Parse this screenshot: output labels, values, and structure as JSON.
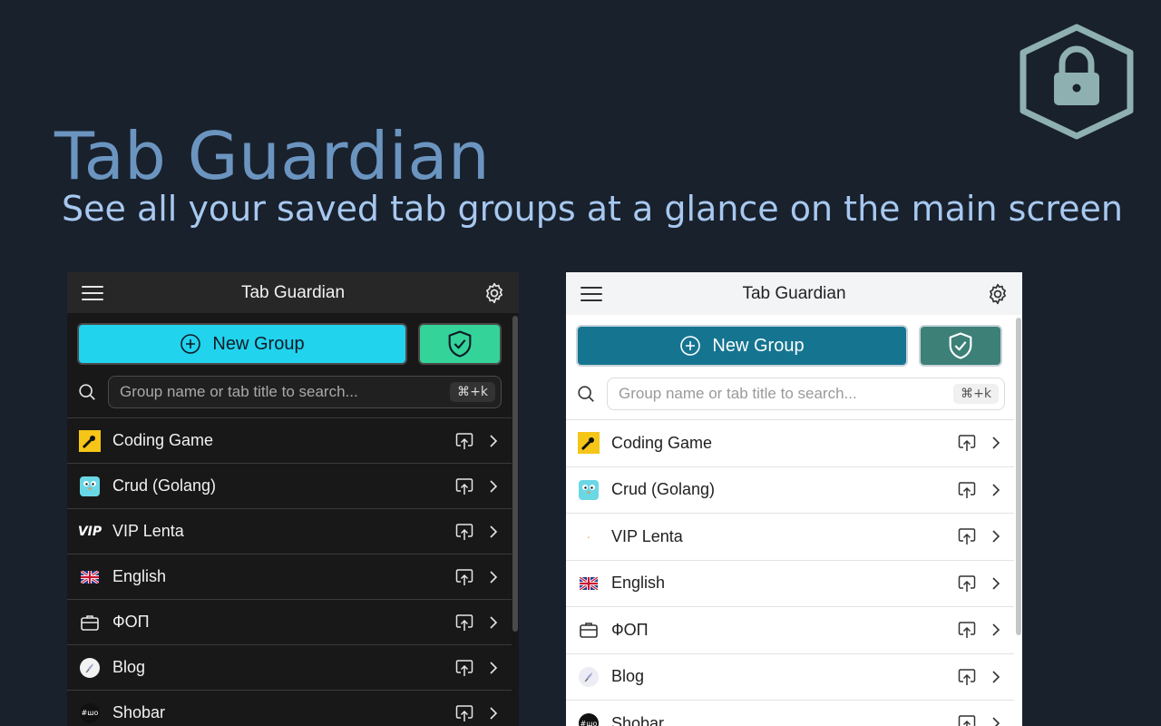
{
  "hero": {
    "title": "Tab Guardian",
    "subtitle": "See all your saved tab groups at a glance on the main screen"
  },
  "colors": {
    "background": "#19212d",
    "title": "#6b95c0",
    "subtitle": "#a7c8ef",
    "logo": "#8fb0b0",
    "dark_new_group": "#22d3ee",
    "dark_shield": "#34d399",
    "light_new_group": "#157591",
    "light_shield": "#3c8078"
  },
  "dark": {
    "header_title": "Tab Guardian",
    "new_group_label": "New Group",
    "search_placeholder": "Group name or tab title to search...",
    "shortcut": "⌘+k"
  },
  "light": {
    "header_title": "Tab Guardian",
    "new_group_label": "New Group",
    "search_placeholder": "Group name or tab title to search...",
    "shortcut": "⌘+k"
  },
  "groups": [
    {
      "name": "Coding Game",
      "icon": "codingame-icon"
    },
    {
      "name": "Crud (Golang)",
      "icon": "gopher-icon"
    },
    {
      "name": "VIP Lenta",
      "icon": "vip-icon"
    },
    {
      "name": "English",
      "icon": "uk-flag-icon"
    },
    {
      "name": "ФОП",
      "icon": "briefcase-icon"
    },
    {
      "name": "Blog",
      "icon": "quill-icon"
    },
    {
      "name": "Shobar",
      "icon": "shobar-icon"
    }
  ],
  "favicon_text": {
    "vip": "VIP",
    "shobar": "#шо"
  }
}
